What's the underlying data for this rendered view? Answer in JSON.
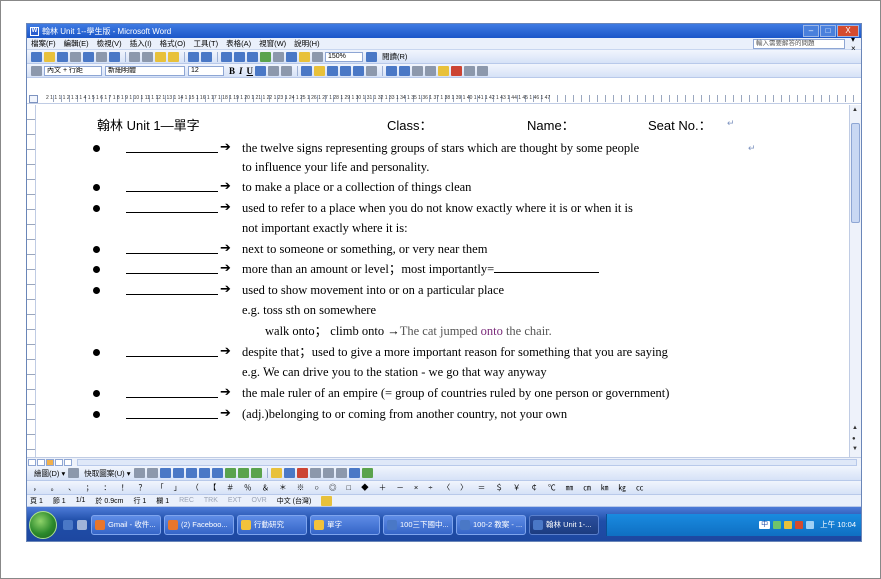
{
  "window": {
    "title": "翰林 Unit 1--學生版 - Microsoft Word",
    "minimize_glyph": "–",
    "maximize_glyph": "□",
    "close_glyph": "X"
  },
  "menu": {
    "items": [
      "檔案(F)",
      "編輯(E)",
      "檢視(V)",
      "插入(I)",
      "格式(O)",
      "工具(T)",
      "表格(A)",
      "視窗(W)",
      "說明(H)"
    ],
    "help_placeholder": "輸入需要解答的問題",
    "close_glyph": "▾ ×"
  },
  "toolbar": {
    "zoom": "150%",
    "reading_label": "閱讀(R)",
    "style_value": "內文 + 行距",
    "font_value": "新細明體",
    "size_value": "12",
    "bold": "B",
    "italic": "I",
    "underline": "U"
  },
  "ruler": {
    "numbers": "2 1 1 1 1 2 1 3 1 4 1 5 1 6 1 7 1 8 1 9 1 10 1 11 1 12 1 13 1 14 1 15 1 16 1 17 1 18 1 19 1 20 1 21 1 22 1 23 1 24 1 25 1 26 1 27 1 28 1 29 1 30 1 31 1 32 1 33 1 34 1 35 1 36 1 37 1 38 1 39 1 40 1 41 1 42 1 43 1 44 1 45 1 46 1 47"
  },
  "document": {
    "header_title": "翰林 Unit 1—單字",
    "header_class": "Class：",
    "header_name": "Name：",
    "header_seat": "Seat No.：",
    "para_mark": "↵",
    "arrow": "➔",
    "items": [
      {
        "def": "the twelve signs representing groups of stars which are thought by some people",
        "cont": "to influence your life and personality."
      },
      {
        "def": "to make a place or a collection of things clean"
      },
      {
        "def": "used to refer to a place when you do not know exactly where it is or when it is",
        "cont": "not important exactly where it is:"
      },
      {
        "def": "next to someone or something, or very near them"
      },
      {
        "def": "more than an amount or level；most importantly="
      },
      {
        "def": "used to show movement into or on a particular place",
        "example_line1": "e.g. toss sth on somewhere",
        "example_line2_a": "walk onto；  climb onto ",
        "example_line2_arrow": "→",
        "example_line2_b": "The cat jumped ",
        "example_line2_onto": "onto",
        "example_line2_c": " the chair."
      },
      {
        "def": "despite that；used to give a more important reason for something that you are saying",
        "cont": "e.g. We can drive you to the station - we go that way anyway"
      },
      {
        "def": "the male ruler of an empire (= group of countries ruled by one person or government)"
      },
      {
        "def": "(adj.)belonging to or coming from another country, not your own"
      }
    ]
  },
  "drawbar": {
    "draw_label": "繪圖(D) ▾",
    "autoshape_label": "快取圖案(U) ▾"
  },
  "symbar": {
    "symbols": "，  。  、  ；  ：  ！  ？  「  」  （  【  ＃  ％  ＆  ＊  ※  ○  ◎  □  ◆  ＋  －  ×  ÷  〈  〉  ＝  ＄  ￥  ￠  ℃  ㎜  ㎝  ㎞  ㎏  ㏄"
  },
  "statusbar": {
    "page": "頁 1",
    "section": "節 1",
    "pages": "1/1",
    "at": "於 0.9cm",
    "line": "行 1",
    "col": "欄 1",
    "rec": "REC",
    "trk": "TRK",
    "ext": "EXT",
    "ovr": "OVR",
    "lang": "中文 (台灣)"
  },
  "taskbar": {
    "tasks": [
      {
        "label": "Gmail - 收件...",
        "color": "#e8762b"
      },
      {
        "label": "(2) Faceboo...",
        "color": "#e8762b"
      },
      {
        "label": "行動研究",
        "color": "#f2c23a"
      },
      {
        "label": "單字",
        "color": "#f2c23a"
      },
      {
        "label": "100三下國中...",
        "color": "#4a78c6"
      },
      {
        "label": "100-2 教案 - ...",
        "color": "#4a78c6"
      },
      {
        "label": "翰林 Unit 1-...",
        "color": "#4a78c6"
      }
    ],
    "clock": "上午 10:04",
    "ime": "中"
  }
}
